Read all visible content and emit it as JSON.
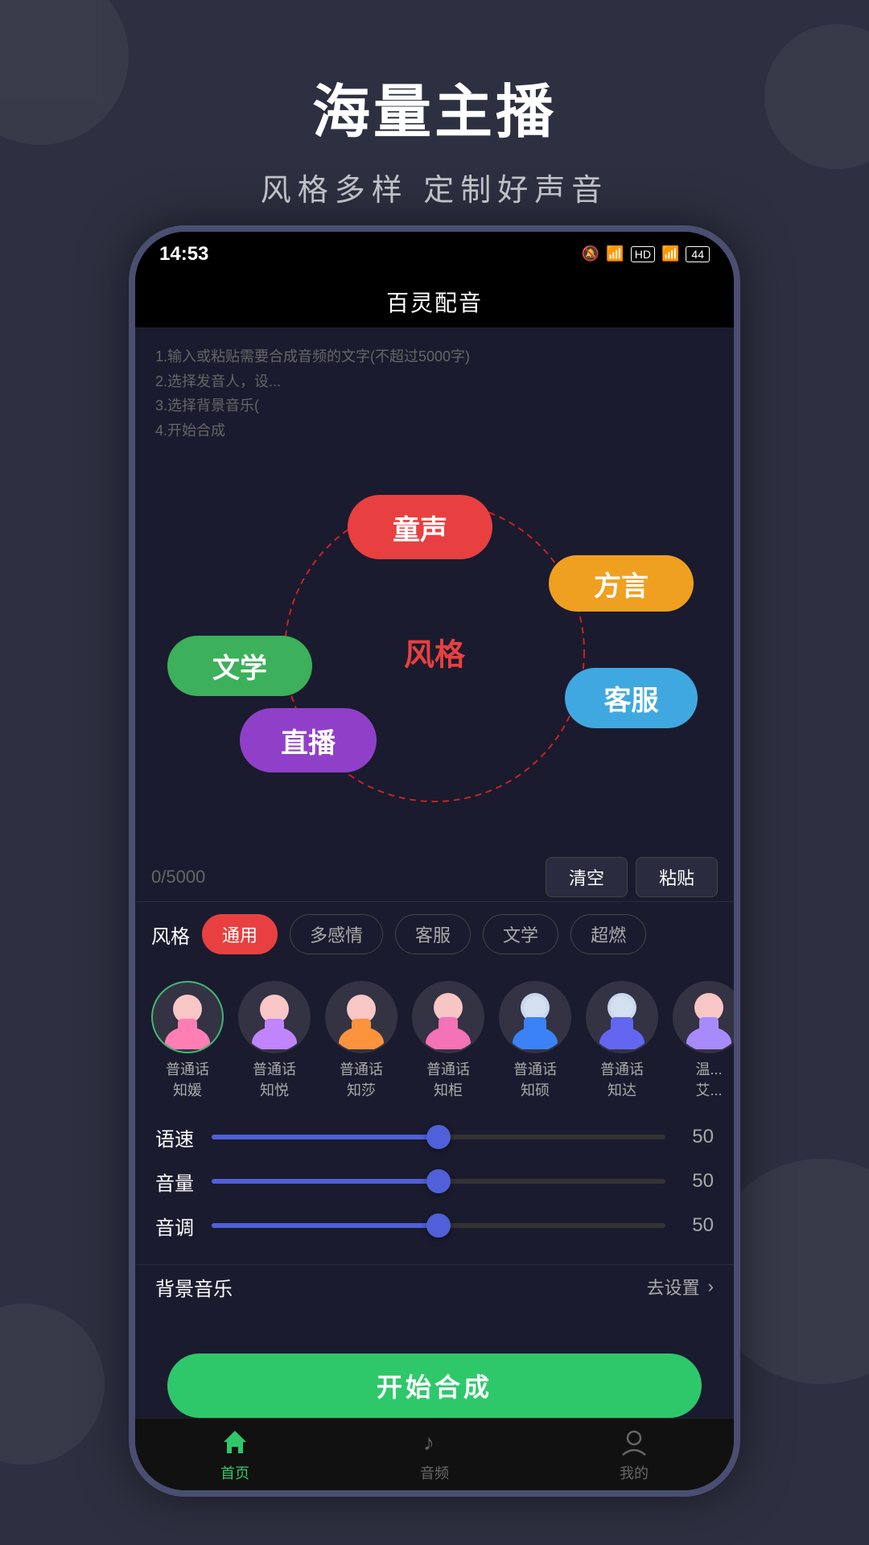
{
  "page": {
    "main_title": "海量主播",
    "sub_title": "风格多样   定制好声音"
  },
  "status_bar": {
    "time": "14:53",
    "icons": "📶🔔HD 4G"
  },
  "app_header": {
    "title": "百灵配音"
  },
  "instructions": {
    "line1": "1.输入或粘贴需要合成音频的文字(不超过5000字)",
    "line2": "2.选择发音人，设...",
    "line3": "3.选择背景音乐(",
    "line4": "4.开始合成"
  },
  "bubbles": {
    "center": "风格",
    "tongsheng": "童声",
    "fangyan": "方言",
    "wenxue": "文学",
    "kefu": "客服",
    "zhibo": "直播"
  },
  "counter": {
    "value": "0/5000"
  },
  "action_buttons": {
    "clear": "清空",
    "paste": "粘贴"
  },
  "style_filter": {
    "label": "风格",
    "tags": [
      "通用",
      "多感情",
      "客服",
      "文学",
      "超燃"
    ]
  },
  "voices": [
    {
      "name": "普通话\n知媛",
      "active": true
    },
    {
      "name": "普通话\n知悦",
      "active": false
    },
    {
      "name": "普通话\n知莎",
      "active": false
    },
    {
      "name": "普通话\n知柜",
      "active": false
    },
    {
      "name": "普通话\n知硕",
      "active": false
    },
    {
      "name": "普通话\n知达",
      "active": false
    },
    {
      "name": "温...\n艾...",
      "active": false
    }
  ],
  "sliders": [
    {
      "label": "语速",
      "value": 50,
      "percent": 50
    },
    {
      "label": "音量",
      "value": 50,
      "percent": 50
    },
    {
      "label": "音调",
      "value": 50,
      "percent": 50
    }
  ],
  "bg_music": {
    "label": "背景音乐",
    "action": "去设置"
  },
  "synthesize_button": {
    "label": "开始合成"
  },
  "bottom_nav": [
    {
      "icon": "home",
      "label": "首页",
      "active": true
    },
    {
      "icon": "music",
      "label": "音频",
      "active": false
    },
    {
      "icon": "user",
      "label": "我的",
      "active": false
    }
  ]
}
